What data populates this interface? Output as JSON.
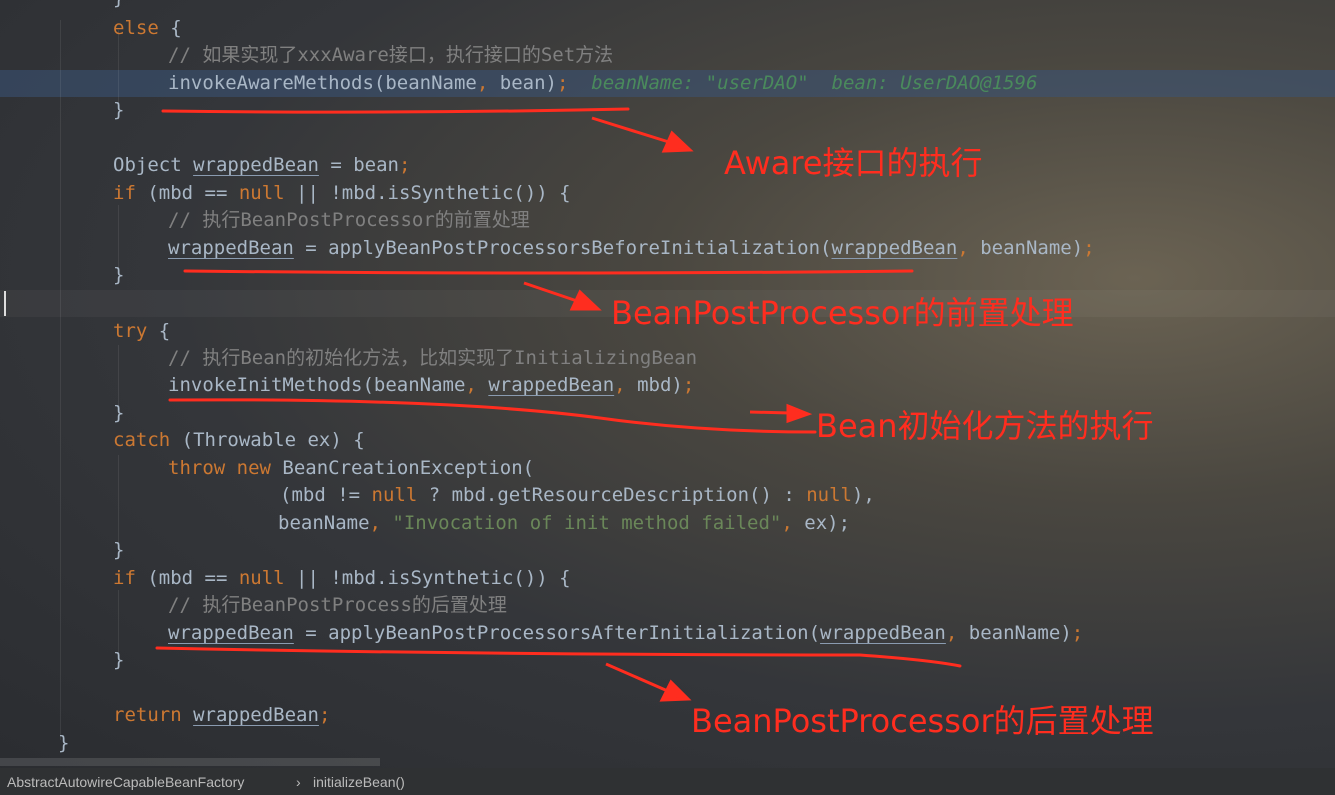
{
  "code": {
    "line_close_top": "}",
    "else_kw": "else",
    "brace_open": "{",
    "comment_aware": "// 如果实现了xxxAware接口，执行接口的Set方法",
    "invoke_aware_name": "invokeAwareMethods",
    "invoke_aware_args_1": "(beanName",
    "comma": ",",
    "invoke_aware_args_2": " bean)",
    "semicolon": ";",
    "hint_beanname": "beanName: \"userDAO\"",
    "hint_bean": "bean: UserDAO@1596",
    "brace_close": "}",
    "object_decl_1": "Object ",
    "wrapped_bean": "wrappedBean",
    "object_decl_2": " = bean",
    "if_kw": "if",
    "if_cond_1": " (mbd == ",
    "null_kw": "null",
    "if_cond_2": " || !mbd.isSynthetic()) {",
    "comment_before": "// 执行BeanPostProcessor的前置处理",
    "apply_before": " = applyBeanPostProcessorsBeforeInitialization(",
    "bean_name": "beanName",
    "close_paren": ")",
    "try_kw": "try",
    "comment_init": "// 执行Bean的初始化方法，比如实现了InitializingBean",
    "invoke_init": "invokeInitMethods(beanName",
    "mbd_close": " mbd)",
    "catch_kw": "catch",
    "catch_args": " (Throwable ex) {",
    "throw_kw": "throw",
    "new_kw": "new",
    "bce": " BeanCreationException(",
    "get_res_1": "(mbd != ",
    "get_res_2": " ? mbd.getResourceDescription() : ",
    "get_res_3": "),",
    "invocation_str": "\"Invocation of init method failed\"",
    "ex_close": " ex);",
    "comment_after": "// 执行BeanPostProcess的后置处理",
    "apply_after": " = applyBeanPostProcessorsAfterInitialization(",
    "return_kw": "return",
    "method_close": "}"
  },
  "annotations": {
    "aware": "Aware接口的执行",
    "before": "BeanPostProcessor的前置处理",
    "init": "Bean初始化方法的执行",
    "after": "BeanPostProcessor的后置处理"
  },
  "statusbar": {
    "class_name": "AbstractAutowireCapableBeanFactory",
    "separator": "›",
    "method_name": "initializeBean()"
  },
  "colors": {
    "keyword": "#cc7832",
    "comment": "#808080",
    "string": "#6a8759",
    "text": "#a9b7c6",
    "annotation": "#ff2d1f"
  }
}
